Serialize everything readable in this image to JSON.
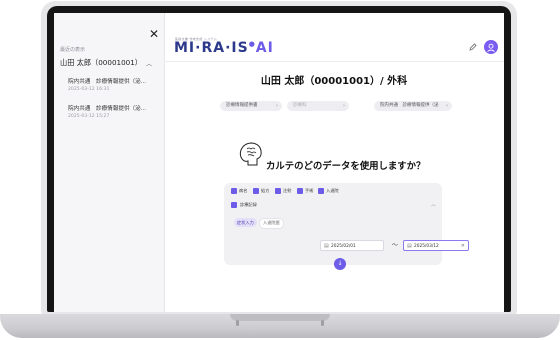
{
  "sidebar": {
    "history_label": "最近の表示",
    "patient": "山田 太郎（00001001）",
    "items": [
      {
        "title": "院内共通　診療情報提供（泌...",
        "date": "2025-03-12 16:31"
      },
      {
        "title": "院内共通　診療情報提供（泌...",
        "date": "2025-03-12 15:27"
      }
    ]
  },
  "header": {
    "logo_small": "医療文書 作成支援 システム",
    "logo_text": "MI·RA·IS",
    "logo_ai": "AI"
  },
  "main": {
    "patient_title": "山田 太郎（00001001）/ 外科",
    "tabs": [
      {
        "label": "診療情報提供書"
      },
      {
        "label": "診療科"
      },
      {
        "label": "院内共通　診療情報提供（泌"
      }
    ],
    "question": "カルテのどのデータを使用しますか？",
    "options": {
      "checkboxes": [
        "病名",
        "処方",
        "注射",
        "手術",
        "入退院"
      ],
      "record_label": "診療記録",
      "chip_active": "症状入力",
      "chip": "入退院歴",
      "date_from": "2025/02/01",
      "date_to": "2025/03/12",
      "range_sep": "〜"
    }
  },
  "colors": {
    "accent": "#6c5ce7",
    "logo": "#2d3a8c"
  },
  "icons": {
    "close": "close-icon",
    "edit": "edit-icon",
    "avatar": "user-icon",
    "next": "arrow-down-icon"
  }
}
